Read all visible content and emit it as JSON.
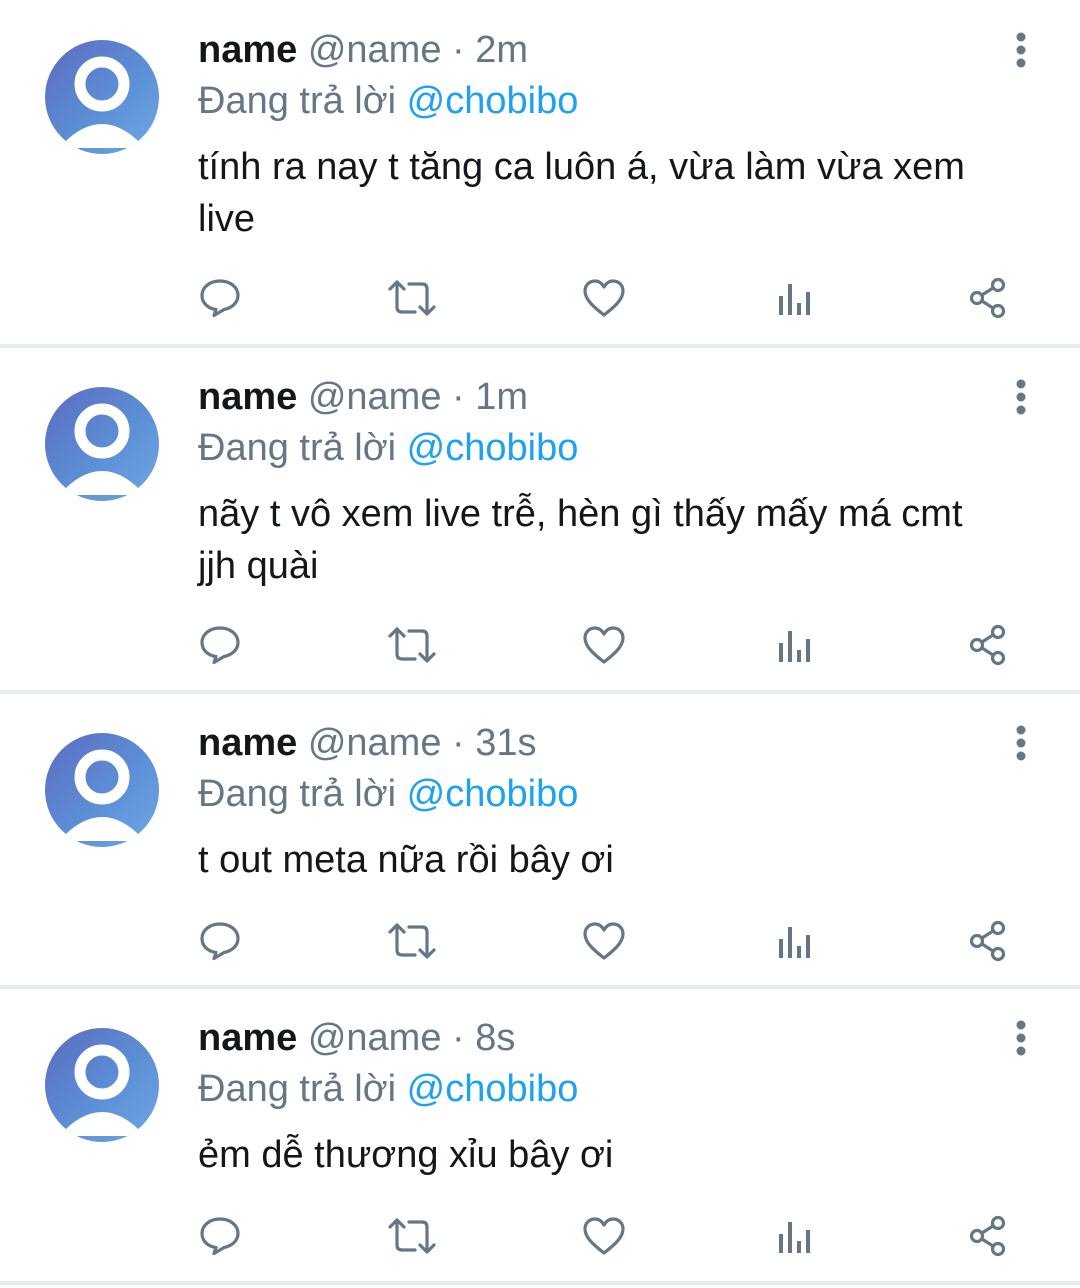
{
  "colors": {
    "name": "#14171a",
    "secondary": "#657786",
    "mention": "#1da1f2",
    "divider": "#e6ecf0",
    "avatar_gradient": [
      "#5c6bc0",
      "#6fa8e4"
    ]
  },
  "icons": {
    "reply": "speech-bubble-icon",
    "retweet": "retweet-arrows-icon",
    "like": "heart-icon",
    "stats": "bar-chart-icon",
    "share": "share-nodes-icon",
    "more": "vertical-dots-icon"
  },
  "tweets": [
    {
      "display_name": "name",
      "handle": "@name",
      "separator": "·",
      "time": "2m",
      "reply_prefix": "Đang trả lời",
      "reply_mention": "@chobibo",
      "text": "tính ra nay t tăng ca luôn á, vừa làm vừa xem live"
    },
    {
      "display_name": "name",
      "handle": "@name",
      "separator": "·",
      "time": "1m",
      "reply_prefix": "Đang trả lời",
      "reply_mention": "@chobibo",
      "text": "nãy t vô xem live trễ, hèn gì thấy mấy má cmt jjh quài"
    },
    {
      "display_name": "name",
      "handle": "@name",
      "separator": "·",
      "time": "31s",
      "reply_prefix": "Đang trả lời",
      "reply_mention": "@chobibo",
      "text": "t out meta nữa rồi bây ơi"
    },
    {
      "display_name": "name",
      "handle": "@name",
      "separator": "·",
      "time": "8s",
      "reply_prefix": "Đang trả lời",
      "reply_mention": "@chobibo",
      "text": "ẻm dễ thương xỉu bây ơi"
    }
  ]
}
